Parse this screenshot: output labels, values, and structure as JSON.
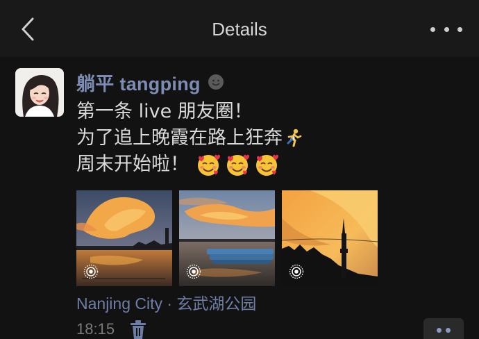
{
  "header": {
    "title": "Details",
    "back_icon": "chevron-left-icon",
    "more_icon": "more-horizontal-icon"
  },
  "post": {
    "username": "躺平 tangping",
    "user_badge_icon": "smiley-face-icon",
    "content_lines": [
      "第一条 live 朋友圈！",
      "为了追上晚霞在路上狂奔",
      "周末开始啦！"
    ],
    "emojis": [
      "running-person-emoji",
      "smiling-face-with-hearts-emoji"
    ],
    "photos": [
      {
        "name": "sunset-clouds-over-lake",
        "live": true
      },
      {
        "name": "sunset-over-boats-dock",
        "live": true
      },
      {
        "name": "sunset-clouds-with-tower",
        "live": true
      }
    ],
    "live_icon": "live-photo-icon",
    "location": "Nanjing City · 玄武湖公园",
    "time": "18:15",
    "delete_icon": "trash-icon",
    "comment_icon": "more-dots-icon"
  },
  "colors": {
    "background": "#121212",
    "header": "#191919",
    "username": "#7d8cb3",
    "link": "#6f7ea6",
    "text": "#dadada",
    "muted": "#7b7b7b"
  }
}
